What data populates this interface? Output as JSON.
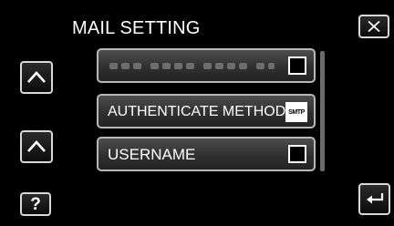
{
  "header": {
    "title": "MAIL SETTING"
  },
  "nav": {
    "close_icon": "close-x-icon",
    "up_icon": "chevron-up-icon",
    "help_label": "?",
    "back_icon": "return-arrow-icon"
  },
  "menu": {
    "items": [
      {
        "label": "",
        "redacted": true,
        "checked": false
      },
      {
        "label": "AUTHENTICATE METHOD",
        "tag": "SMTP"
      },
      {
        "label": "USERNAME",
        "checked": false
      }
    ]
  },
  "colors": {
    "background": "#000000",
    "button_border": "#d8d8d8",
    "item_fill": "#3a3a3a",
    "text": "#ffffff"
  }
}
